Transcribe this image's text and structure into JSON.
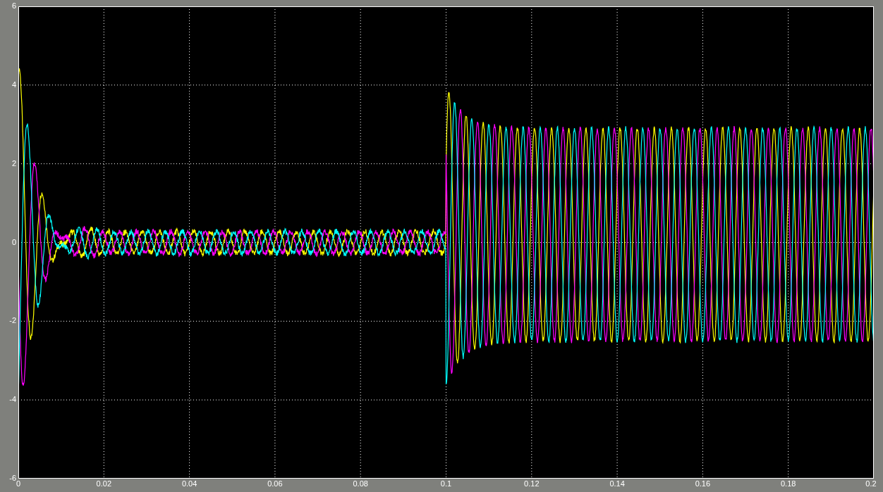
{
  "scope": {
    "y_ticks": [
      "6",
      "4",
      "2",
      "0",
      "-2",
      "-4",
      "-6"
    ],
    "x_ticks": [
      "0",
      "0.02",
      "0.04",
      "0.06",
      "0.08",
      "0.1",
      "0.12",
      "0.14",
      "0.16",
      "0.18",
      "0.2"
    ],
    "traces": [
      {
        "color": "#ffff00"
      },
      {
        "color": "#ff00ff"
      },
      {
        "color": "#00ffff"
      }
    ]
  }
}
